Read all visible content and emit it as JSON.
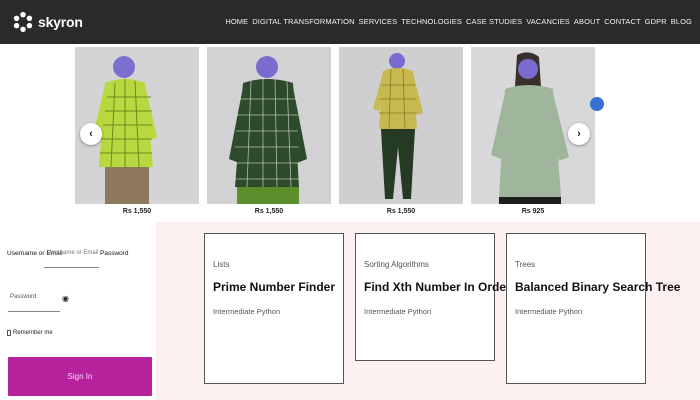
{
  "header": {
    "logo_text": "skyron",
    "nav": [
      "HOME",
      "DIGITAL TRANSFORMATION",
      "SERVICES",
      "TECHNOLOGIES",
      "CASE STUDIES",
      "VACANCIES",
      "ABOUT",
      "CONTACT",
      "GDPR",
      "BLOG"
    ]
  },
  "carousel": {
    "products": [
      {
        "price": "Rs 1,550",
        "shirt_color": "#b8d840",
        "pattern": "check",
        "pants_color": "#8d7a5c"
      },
      {
        "price": "Rs 1,550",
        "shirt_color": "#2d4a2c",
        "pattern": "check",
        "pants_color": "#5a8f2c"
      },
      {
        "price": "Rs 1,550",
        "shirt_color": "#c8b850",
        "pattern": "check",
        "pants_color": "#243a22"
      },
      {
        "price": "Rs 925",
        "shirt_color": "#9fb59c",
        "pattern": "plain",
        "pants_color": "#9fb59c"
      }
    ],
    "prev_icon": "‹",
    "next_icon": "›"
  },
  "login": {
    "username_label": "Username or Email",
    "username_placeholder": "Username or Email",
    "password_label": "Password",
    "password_placeholder": "Password",
    "remember_label": "Remember me",
    "signin_label": "Sign In",
    "accent": "#b8229c"
  },
  "problems": [
    {
      "category": "Lists",
      "title": "Prime Number Finder",
      "level": "Intermediate",
      "language": "Python"
    },
    {
      "category": "Sorting Algorithms",
      "title": "Find Xth Number In Order",
      "level": "Intermediate",
      "language": "Python"
    },
    {
      "category": "Trees",
      "title": "Balanced Binary Search Tree",
      "level": "Intermediate",
      "language": "Python"
    }
  ]
}
